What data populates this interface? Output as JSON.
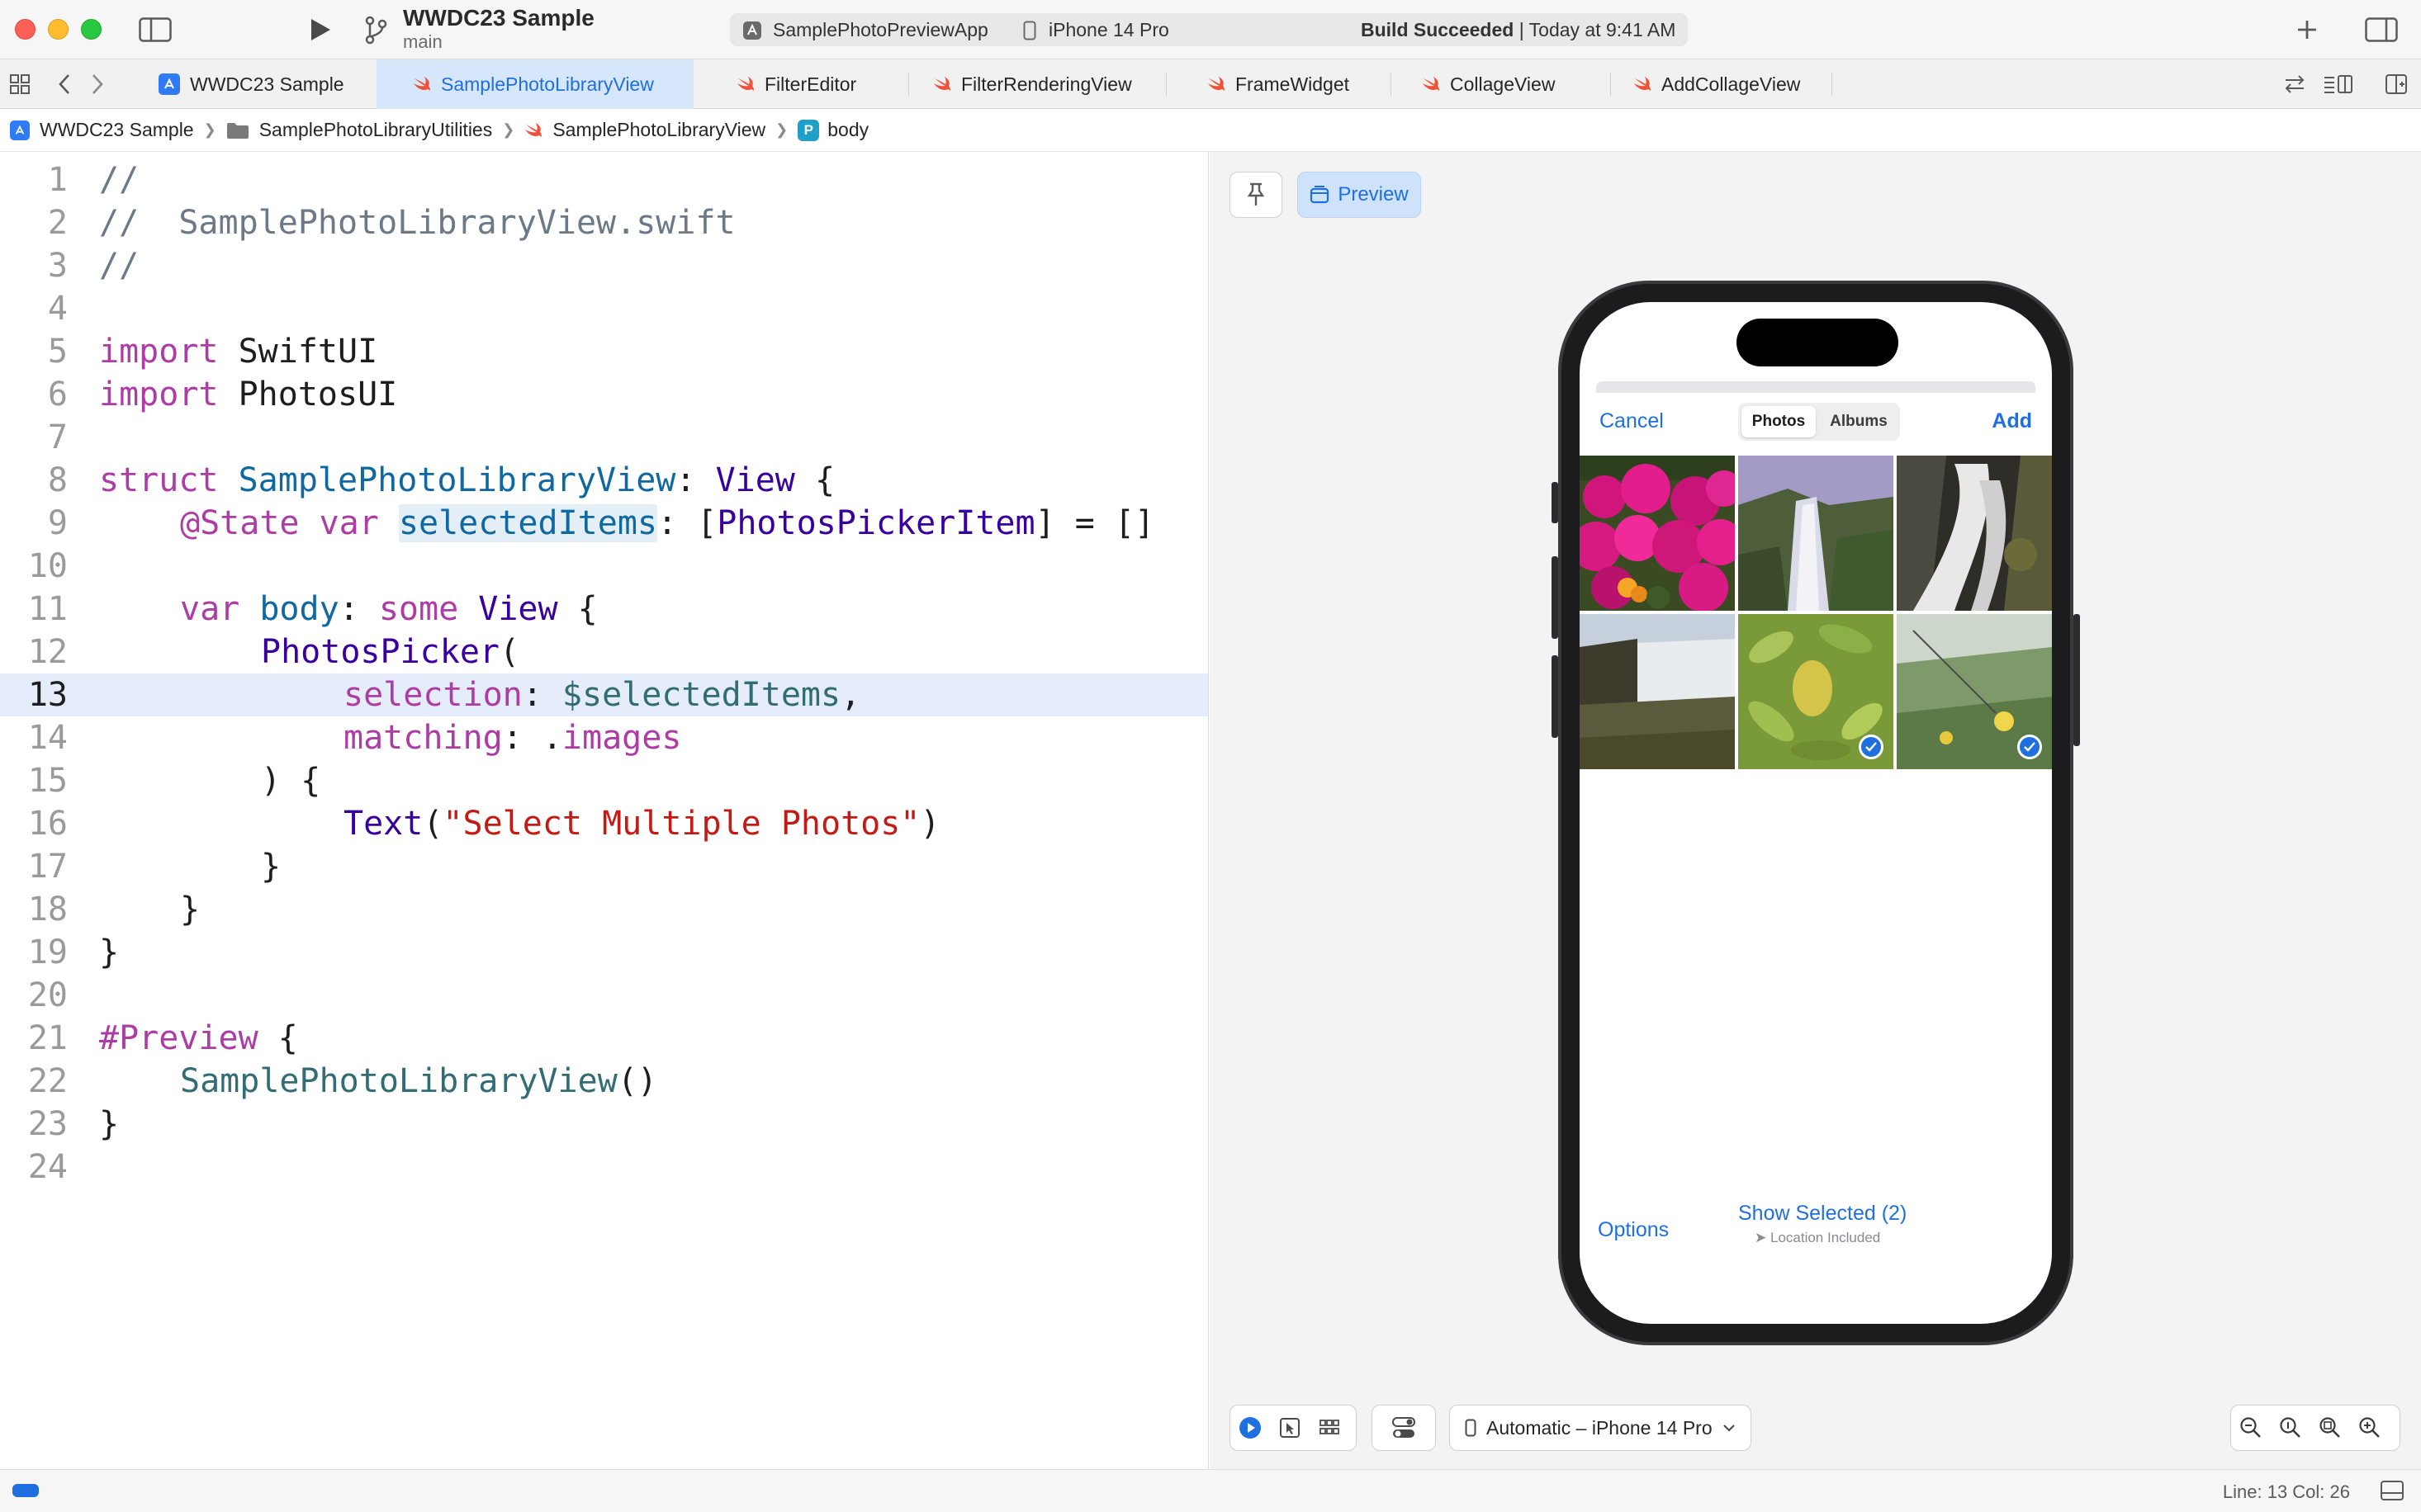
{
  "titlebar": {
    "project_name": "WWDC23 Sample",
    "branch": "main",
    "scheme_app": "SamplePhotoPreviewApp",
    "scheme_device": "iPhone 14 Pro",
    "build_status_bold": "Build Succeeded",
    "build_status_time": "| Today at 9:41 AM"
  },
  "tabs": [
    {
      "label": "WWDC23 Sample",
      "icon": "xcode-project-icon"
    },
    {
      "label": "SamplePhotoLibraryView",
      "icon": "swift-file-icon",
      "active": true
    },
    {
      "label": "FilterEditor",
      "icon": "swift-file-icon"
    },
    {
      "label": "FilterRenderingView",
      "icon": "swift-file-icon"
    },
    {
      "label": "FrameWidget",
      "icon": "swift-file-icon"
    },
    {
      "label": "CollageView",
      "icon": "swift-file-icon"
    },
    {
      "label": "AddCollageView",
      "icon": "swift-file-icon"
    }
  ],
  "jumpbar": {
    "project": "WWDC23 Sample",
    "folder": "SamplePhotoLibraryUtilities",
    "file": "SamplePhotoLibraryView",
    "symbol_badge": "P",
    "symbol": "body"
  },
  "code": {
    "current_line": 13,
    "line_numbers": [
      "1",
      "2",
      "3",
      "4",
      "5",
      "6",
      "7",
      "8",
      "9",
      "10",
      "11",
      "12",
      "13",
      "14",
      "15",
      "16",
      "17",
      "18",
      "19",
      "20",
      "21",
      "22",
      "23",
      "24"
    ],
    "l1": "//",
    "l2": "//  SamplePhotoLibraryView.swift",
    "l3": "//",
    "l5_kw": "import",
    "l5_mod": " SwiftUI",
    "l6_kw": "import",
    "l6_mod": " PhotosUI",
    "l8_kw": "struct",
    "l8_name": " SamplePhotoLibraryView",
    "l8_colon": ": ",
    "l8_type": "View",
    "l8_brace": " {",
    "l9_attr": "@State",
    "l9_var": " var ",
    "l9_name": "selectedItems",
    "l9_colon": ": [",
    "l9_type": "PhotosPickerItem",
    "l9_rest": "] = []",
    "l11_var": "var ",
    "l11_name": "body",
    "l11_colon": ": ",
    "l11_some": "some",
    "l11_sp": " ",
    "l11_type": "View",
    "l11_brace": " {",
    "l12_type": "PhotosPicker",
    "l12_paren": "(",
    "l13_label": "selection",
    "l13_colon": ": ",
    "l13_value": "$selectedItems",
    "l13_comma": ",",
    "l14_label": "matching",
    "l14_colon": ": .",
    "l14_value": "images",
    "l15": ") {",
    "l16_type": "Text",
    "l16_open": "(",
    "l16_str": "\"Select Multiple Photos\"",
    "l16_close": ")",
    "l17": "}",
    "l18": "}",
    "l19": "}",
    "l21_macro": "#Preview",
    "l21_brace": " {",
    "l22_type": "SamplePhotoLibraryView",
    "l22_paren": "()",
    "l23": "}"
  },
  "canvas": {
    "preview_label": "Preview",
    "device_picker": "Automatic – iPhone 14 Pro"
  },
  "picker": {
    "cancel": "Cancel",
    "seg_photos": "Photos",
    "seg_albums": "Albums",
    "add": "Add",
    "options": "Options",
    "show_selected": "Show Selected (2)",
    "location": "Location Included",
    "photos": [
      {
        "name": "pink-flowers-photo",
        "selected": false
      },
      {
        "name": "waterfall-mist-photo",
        "selected": false
      },
      {
        "name": "waterfall-rocks-photo",
        "selected": false
      },
      {
        "name": "waterfall-cliff-photo",
        "selected": false
      },
      {
        "name": "green-leaves-photo",
        "selected": true
      },
      {
        "name": "succulent-plant-photo",
        "selected": true
      }
    ]
  },
  "statusbar": {
    "position": "Line: 13  Col: 26"
  }
}
